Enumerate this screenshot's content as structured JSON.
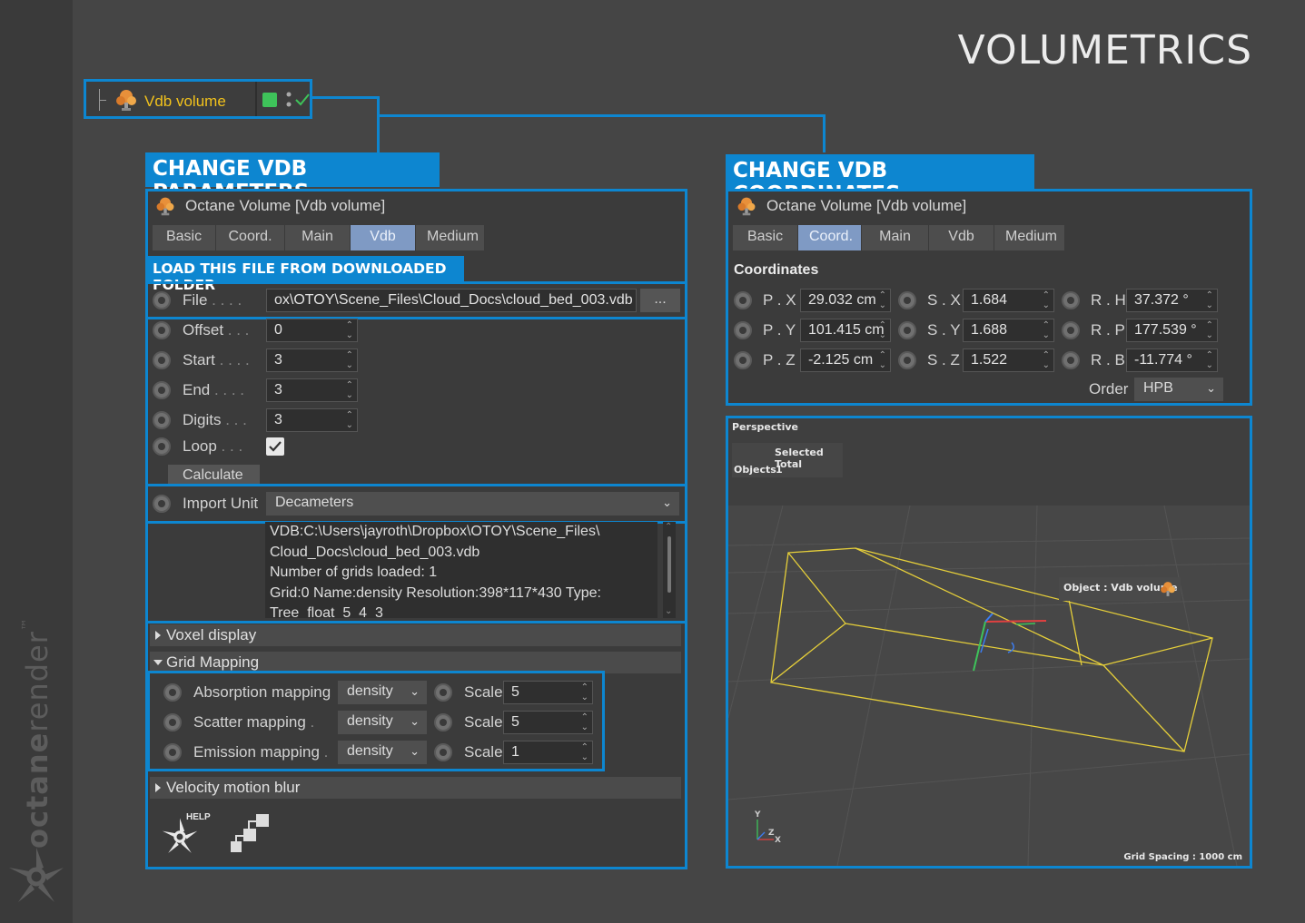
{
  "page_title": "VOLUMETRICS",
  "brand": {
    "left": "octane",
    "right": "render",
    "tm": "™"
  },
  "node": {
    "label": "Vdb volume"
  },
  "left_section": {
    "header": "CHANGE VDB PARAMETERS",
    "object_title": "Octane Volume [Vdb volume]",
    "tabs": [
      "Basic",
      "Coord.",
      "Main",
      "Vdb",
      "Medium"
    ],
    "active_tab": "Vdb",
    "load_banner": "LOAD THIS FILE FROM DOWNLOADED FOLDER",
    "file": {
      "label": "File",
      "value": "ox\\OTOY\\Scene_Files\\Cloud_Docs\\cloud_bed_003.vdb",
      "browse": "..."
    },
    "offset": {
      "label": "Offset",
      "value": "0"
    },
    "start": {
      "label": "Start",
      "value": "3"
    },
    "end": {
      "label": "End",
      "value": "3"
    },
    "digits": {
      "label": "Digits",
      "value": "3"
    },
    "loop": {
      "label": "Loop",
      "checked": true
    },
    "calculate": "Calculate",
    "import_unit": {
      "label": "Import Unit",
      "value": "Decameters"
    },
    "info_lines": [
      "VDB:C:\\Users\\jayroth\\Dropbox\\OTOY\\Scene_Files\\",
      "Cloud_Docs\\cloud_bed_003.vdb",
      "Number of grids loaded: 1",
      "Grid:0  Name:density  Resolution:398*117*430  Type:",
      "Tree_float_5_4_3"
    ],
    "voxel_display": "Voxel display",
    "grid_mapping": "Grid Mapping",
    "mappings": [
      {
        "label": "Absorption mapping",
        "value": "density",
        "scale_label": "Scale",
        "scale": "5"
      },
      {
        "label": "Scatter mapping",
        "value": "density",
        "scale_label": "Scale",
        "scale": "5"
      },
      {
        "label": "Emission mapping",
        "value": "density",
        "scale_label": "Scale",
        "scale": "1"
      }
    ],
    "velocity_motion_blur": "Velocity motion blur",
    "help_label": "HELP"
  },
  "right_section": {
    "header": "CHANGE VDB COORDINATES",
    "object_title": "Octane Volume [Vdb volume]",
    "tabs": [
      "Basic",
      "Coord.",
      "Main",
      "Vdb",
      "Medium"
    ],
    "active_tab": "Coord.",
    "coordinates_label": "Coordinates",
    "rows": [
      {
        "p_label": "P . X",
        "p": "29.032 cm",
        "s_label": "S . X",
        "s": "1.684",
        "r_label": "R . H",
        "r": "37.372 °"
      },
      {
        "p_label": "P . Y",
        "p": "101.415 cm",
        "s_label": "S . Y",
        "s": "1.688",
        "r_label": "R . P",
        "r": "177.539 °"
      },
      {
        "p_label": "P . Z",
        "p": "-2.125 cm",
        "s_label": "S . Z",
        "s": "1.522",
        "r_label": "R . B",
        "r": "-11.774 °"
      }
    ],
    "order_label": "Order",
    "order_value": "HPB"
  },
  "viewport": {
    "name": "Perspective",
    "selected_total": "Selected Total",
    "objects_label": "Objects",
    "objects_count": "1",
    "object_tag": "Object : Vdb volume",
    "grid_spacing": "Grid Spacing : 1000 cm",
    "axis_y": "Y",
    "axis_z": "Z",
    "axis_x": "X"
  },
  "colors": {
    "accent": "#0d86d0",
    "node_label": "#f2c21c",
    "active_tab": "#7f9ac4",
    "status_green": "#3ec35a",
    "bbox": "#e6cf3a"
  }
}
